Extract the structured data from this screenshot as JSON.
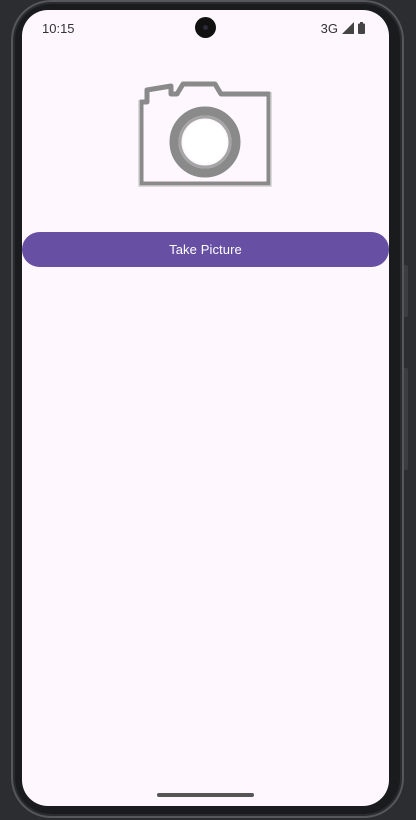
{
  "status_bar": {
    "time": "10:15",
    "network": "3G",
    "signal_icon": "signal-icon",
    "battery_icon": "battery-icon"
  },
  "main": {
    "photo_placeholder_icon": "camera-icon",
    "take_picture_label": "Take Picture"
  },
  "colors": {
    "background": "#fef7fd",
    "primary_button": "#6750a4",
    "button_text": "#ffffff"
  }
}
